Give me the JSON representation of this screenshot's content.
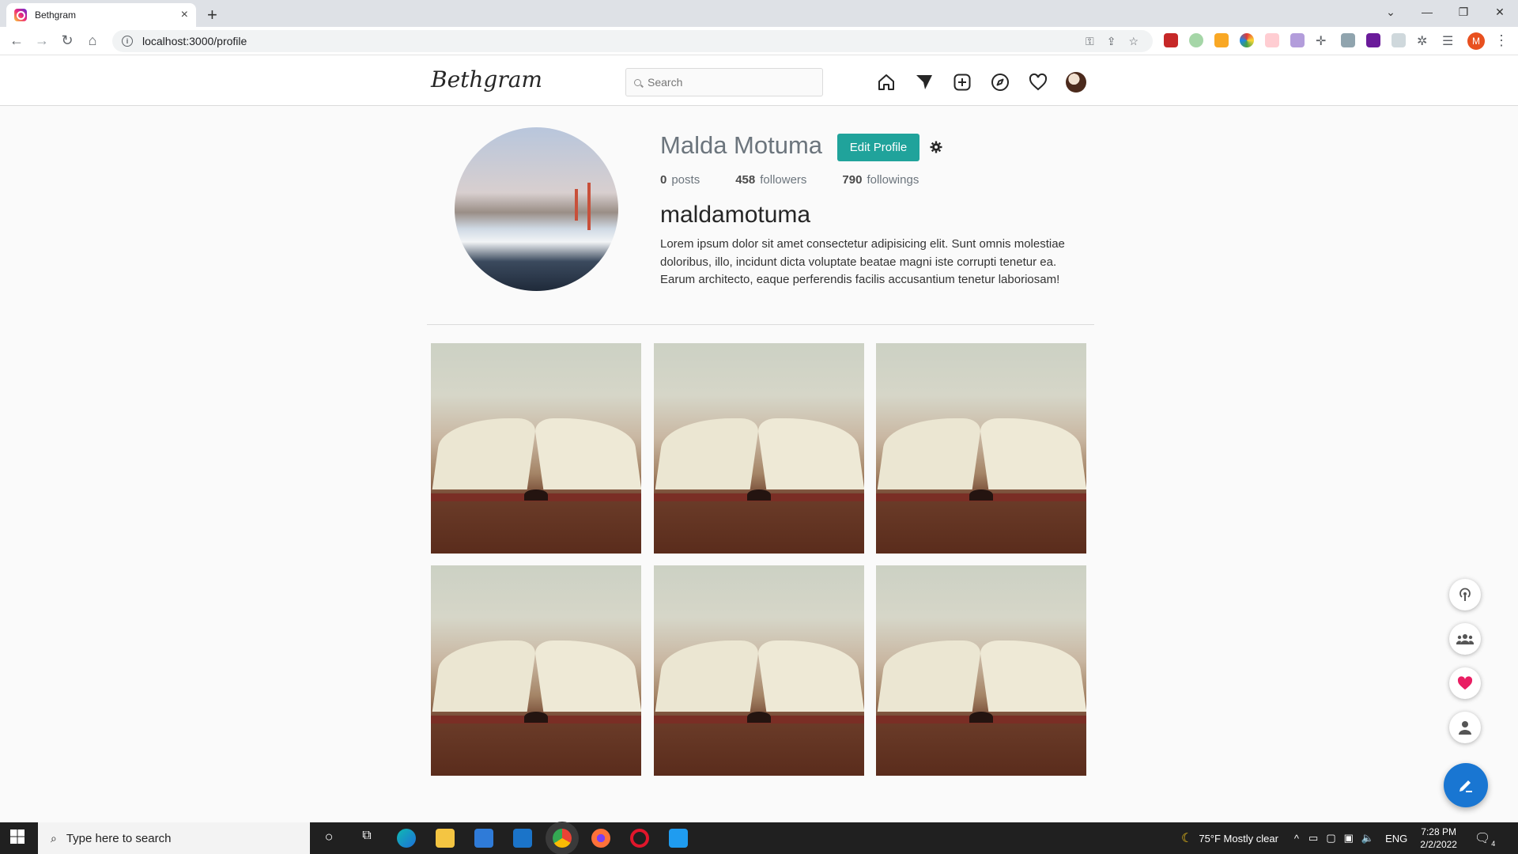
{
  "browser": {
    "tab_title": "Bethgram",
    "tab_close": "×",
    "new_tab": "+",
    "url": "localhost:3000/profile",
    "profile_initial": "M"
  },
  "header": {
    "logo": "Bethgram",
    "search_placeholder": "Search"
  },
  "profile": {
    "display_name": "Malda Motuma",
    "edit_button": "Edit Profile",
    "stats": [
      {
        "value": "0",
        "label": "posts"
      },
      {
        "value": "458",
        "label": "followers"
      },
      {
        "value": "790",
        "label": "followings"
      }
    ],
    "username": "maldamotuma",
    "bio": "Lorem ipsum dolor sit amet consectetur adipisicing elit. Sunt omnis molestiae doloribus, illo, incidunt dicta voluptate beatae magni iste corrupti tenetur ea. Earum architecto, eaque perferendis facilis accusantium tenetur laboriosam!"
  },
  "posts_count_shown": 6,
  "floating": [
    "podcast-icon",
    "group-icon",
    "heart-icon",
    "person-icon",
    "edit-icon"
  ],
  "taskbar": {
    "search_placeholder": "Type here to search",
    "weather": "75°F  Mostly clear",
    "lang": "ENG",
    "time": "7:28 PM",
    "date": "2/2/2022",
    "notifications": "4"
  },
  "colors": {
    "accent": "#20a39b",
    "fab": "#1976d2",
    "heart": "#e91e63"
  }
}
